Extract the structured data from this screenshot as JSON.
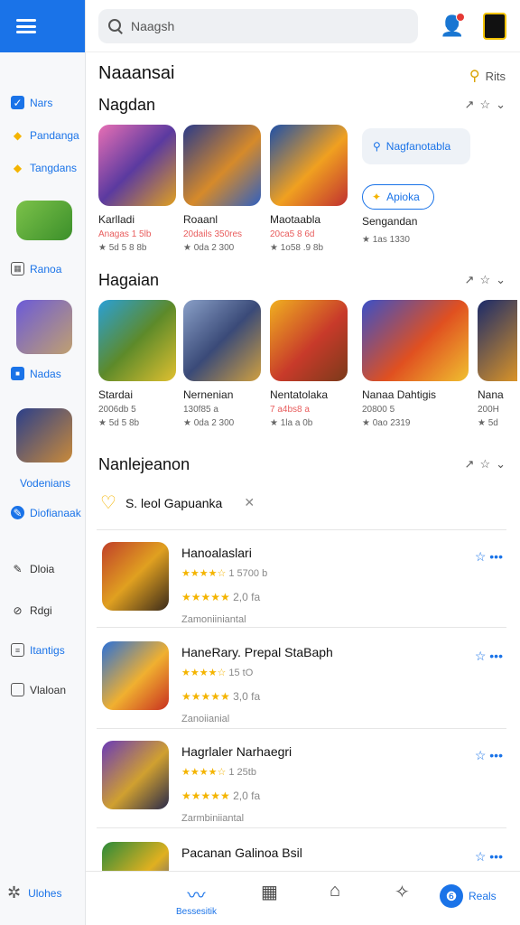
{
  "header": {
    "search_placeholder": "Naagsh",
    "accent": "#1a73e8"
  },
  "sidebar": {
    "items": [
      {
        "label": "Nars",
        "icon": "check-square-icon"
      },
      {
        "label": "Pandanga",
        "icon": "diamond-icon"
      },
      {
        "label": "Tangdans",
        "icon": "diamond-icon"
      },
      {
        "label": "Ranoa",
        "icon": "grid-icon"
      },
      {
        "label": "Nadas",
        "icon": "square-icon"
      },
      {
        "label": "Vodenians",
        "icon": ""
      },
      {
        "label": "Diofianaak",
        "icon": "badge-icon"
      },
      {
        "label": "Dloia",
        "icon": "pencil-icon"
      },
      {
        "label": "Rdgi",
        "icon": "circle-slash-icon"
      },
      {
        "label": "Itantigs",
        "icon": "document-icon"
      },
      {
        "label": "Vlaloan",
        "icon": "square-outline-icon"
      }
    ],
    "footer_label": "Ulohes"
  },
  "main": {
    "title": "Naaansai",
    "title_action": "Rits",
    "section1": {
      "title": "Nagdan",
      "cards": [
        {
          "title": "Karlladi",
          "meta1": "Anagas 1 5lb",
          "meta2": "★ 5d 5 8 8b"
        },
        {
          "title": "Roaanl",
          "meta1": "20dails 350res",
          "meta2": "★ 0da 2 300"
        },
        {
          "title": "Maotaabla",
          "meta1": "20ca5 8 6d",
          "meta2": "★ 1o58 .9 8b"
        },
        {
          "title": "Sengandan",
          "meta1": "",
          "meta2": "★ 1as 1330"
        }
      ],
      "pill_primary": "Nagfanotabla",
      "pill_secondary": "Apioka"
    },
    "section2": {
      "title": "Hagaian",
      "cards": [
        {
          "title": "Stardai",
          "meta1": "2006db 5",
          "meta2": "★ 5d 5 8b"
        },
        {
          "title": "Nernenian",
          "meta1": "130f85 a",
          "meta2": "★ 0da 2 300"
        },
        {
          "title": "Nentatolaka",
          "meta1": "7 a4bs8 a",
          "meta2": "★ 1la a 0b"
        },
        {
          "title": "Nanaa Dahtigis",
          "meta1": "20800 5",
          "meta2": "★ 0ao 2319"
        },
        {
          "title": "Nana",
          "meta1": "200H",
          "meta2": "★ 5d"
        }
      ]
    },
    "section3": {
      "title": "Nanlejeanon",
      "chip": "S. leol Gapuanka",
      "rows": [
        {
          "name": "Hanoalaslari",
          "rating1": "1 5700 b",
          "rating2": "2,0 fa",
          "sub": "Zamoniiniantal"
        },
        {
          "name": "HaneRary. Prepal StaBaph",
          "rating1": "15 tO",
          "rating2": "3,0 fa",
          "sub": "Zanoiianial"
        },
        {
          "name": "Hagrlaler Narhaegri",
          "rating1": "1 25tb",
          "rating2": "2,0 fa",
          "sub": "Zarmbiniiantal"
        },
        {
          "name": "Pacanan Galinoa Bsil",
          "rating1": "",
          "rating2": "",
          "sub": ""
        }
      ]
    }
  },
  "bottom": {
    "items": [
      {
        "label": "Bessesitik",
        "icon": "swoosh-icon"
      },
      {
        "label": "",
        "icon": "grid-icon"
      },
      {
        "label": "",
        "icon": "house-icon"
      },
      {
        "label": "",
        "icon": "puzzle-icon"
      },
      {
        "label": "Reals",
        "icon": "badge-icon"
      }
    ]
  }
}
